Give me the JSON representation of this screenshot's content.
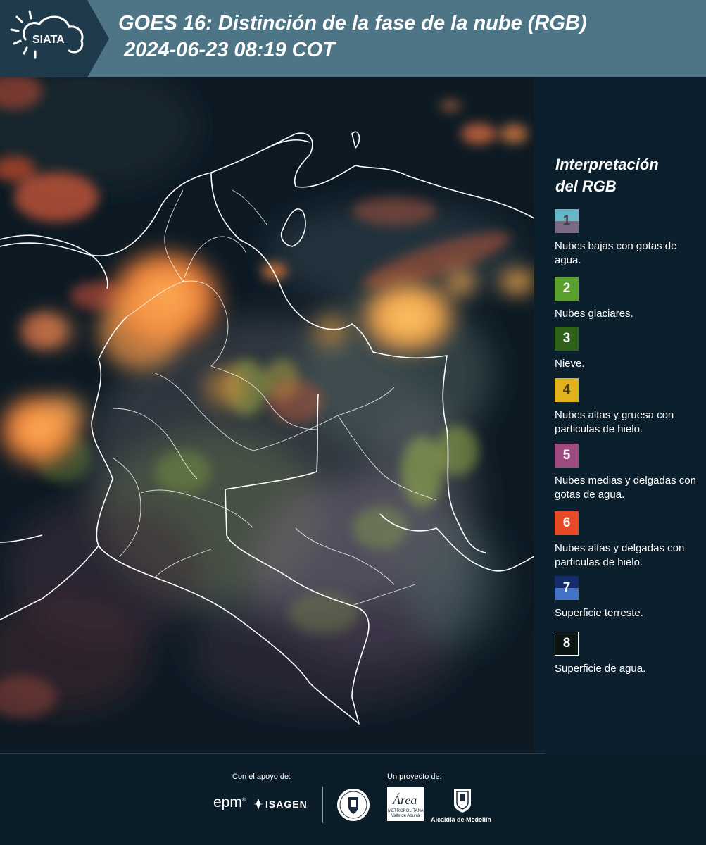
{
  "header": {
    "brand": "SIATA",
    "title_line1": "GOES 16: Distinción de la fase de la nube (RGB)",
    "title_line2": "2024-06-23 08:19 COT"
  },
  "legend": {
    "title_line1": "Interpretación",
    "title_line2": "del RGB",
    "items": [
      {
        "number": "1",
        "label": "Nubes bajas con gotas de agua.",
        "color_top": "#66b8c8",
        "color_bottom": "#7b6a86",
        "text_color": "#3f3f4f"
      },
      {
        "number": "2",
        "label": "Nubes glaciares.",
        "color_top": "#5aa02c",
        "color_bottom": "#5aa02c",
        "text_color": "#ffffff"
      },
      {
        "number": "3",
        "label": "Nieve.",
        "color_top": "#2e6219",
        "color_bottom": "#2e6219",
        "text_color": "#ffffff"
      },
      {
        "number": "4",
        "label": "Nubes altas y gruesa con particulas de hielo.",
        "color_top": "#e0b21c",
        "color_bottom": "#e0b21c",
        "text_color": "#4a3a10"
      },
      {
        "number": "5",
        "label": "Nubes medias y delgadas con gotas de agua.",
        "color_top": "#a04a82",
        "color_bottom": "#a04a82",
        "text_color": "#ffffff"
      },
      {
        "number": "6",
        "label": "Nubes altas y delgadas con particulas de hielo.",
        "color_top": "#e84a26",
        "color_bottom": "#e84a26",
        "text_color": "#ffffff"
      },
      {
        "number": "7",
        "label": "Superficie terreste.",
        "color_top": "#142c6a",
        "color_bottom": "#4472c4",
        "text_color": "#ffffff"
      },
      {
        "number": "8",
        "label": "Superficie de agua.",
        "color_top": "#0a1410",
        "color_bottom": "#0a1410",
        "text_color": "#ffffff"
      }
    ]
  },
  "footer": {
    "support_label": "Con el apoyo de:",
    "project_label": "Un proyecto de:",
    "epm": "epm",
    "isagen": "ISAGEN",
    "area_metropolitana": "METROPOLITANA Valle de Aburrá",
    "area_script": "Área",
    "alcaldia": "Alcaldía de Medellín"
  }
}
